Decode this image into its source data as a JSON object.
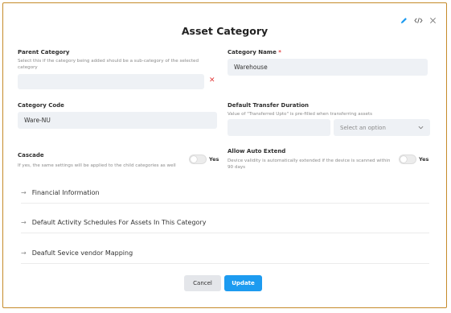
{
  "dialog": {
    "title": "Asset Category"
  },
  "fields": {
    "parent_category": {
      "label": "Parent Category",
      "help": "Select this if the category being added should be a sub-category of the selected category",
      "value": ""
    },
    "category_name": {
      "label": "Category Name",
      "required_mark": "*",
      "value": "Warehouse"
    },
    "category_code": {
      "label": "Category Code",
      "value": "Ware-NU"
    },
    "default_transfer_duration": {
      "label": "Default Transfer Duration",
      "help": "Value of \"Transferred Upto\" is pre-filled when transferring assets",
      "value": "",
      "unit_placeholder": "Select an option"
    },
    "cascade": {
      "label": "Cascade",
      "help": "If yes, the same settings will be applied to the child categories as well",
      "toggle_label": "Yes",
      "toggle_on": false
    },
    "allow_auto_extend": {
      "label": "Allow Auto Extend",
      "help": "Device validity is automatically extended if the device is scanned within 90 days",
      "toggle_label": "Yes",
      "toggle_on": false
    }
  },
  "sections": [
    {
      "label": "Financial Information"
    },
    {
      "label": "Default Activity Schedules For Assets In This Category"
    },
    {
      "label": "Deafult Sevice vendor Mapping"
    }
  ],
  "buttons": {
    "cancel": "Cancel",
    "update": "Update"
  },
  "icons": {
    "edit": "pencil-icon",
    "code": "code-icon",
    "close": "close-icon",
    "clear": "x-icon",
    "dropdown": "chevron-down-icon",
    "section": "arrow-right-icon"
  },
  "colors": {
    "accent": "#1d9bf0",
    "danger": "#e23b3b",
    "frame": "#c58b2a"
  }
}
